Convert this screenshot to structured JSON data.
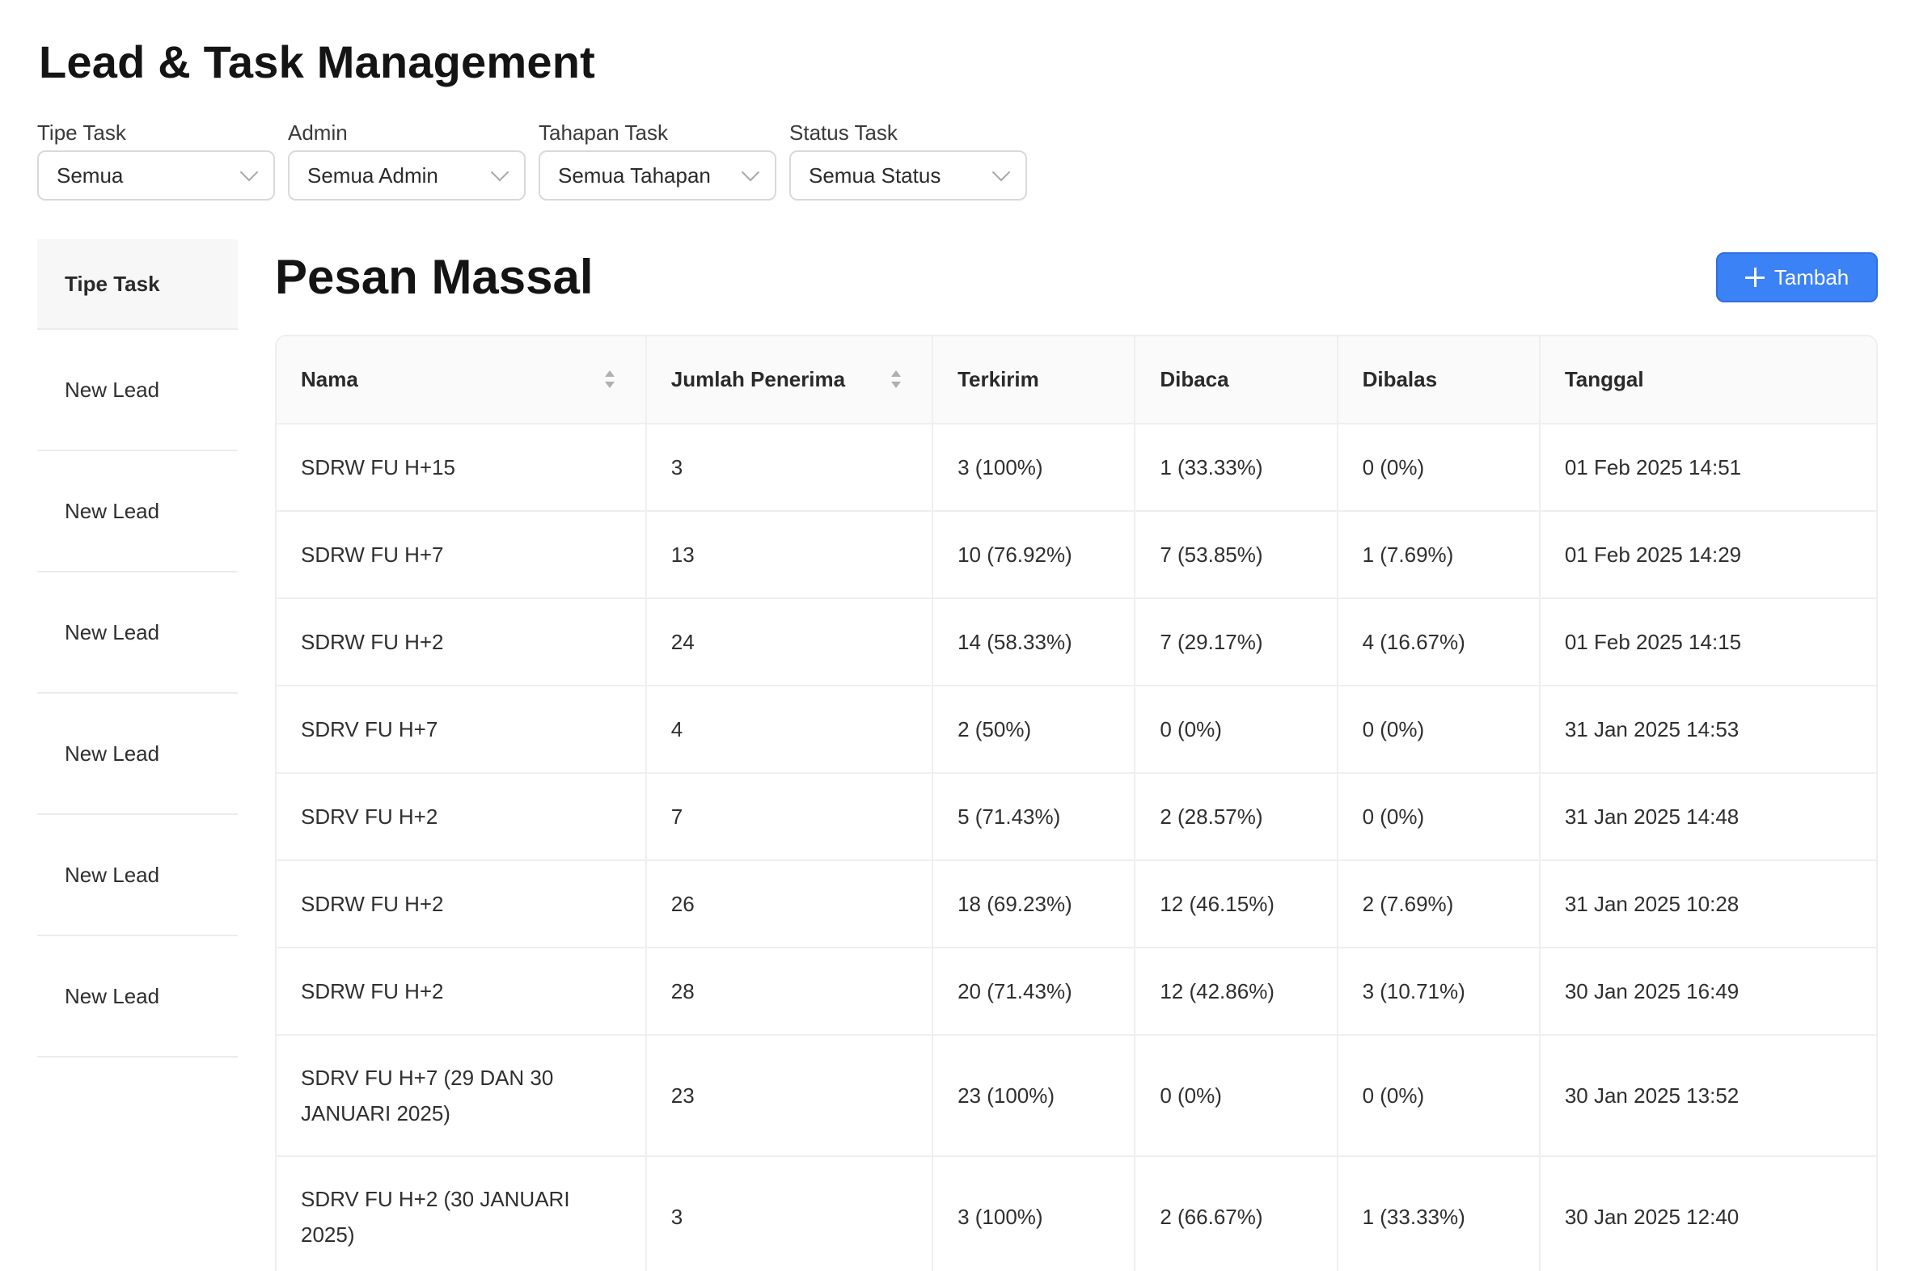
{
  "page_title": "Lead & Task Management",
  "filters": [
    {
      "label": "Tipe Task",
      "value": "Semua"
    },
    {
      "label": "Admin",
      "value": "Semua Admin"
    },
    {
      "label": "Tahapan Task",
      "value": "Semua Tahapan"
    },
    {
      "label": "Status Task",
      "value": "Semua Status"
    }
  ],
  "sidebar": {
    "header": "Tipe Task",
    "items": [
      "New Lead",
      "New Lead",
      "New Lead",
      "New Lead",
      "New Lead",
      "New Lead"
    ]
  },
  "section": {
    "title": "Pesan Massal",
    "add_label": "Tambah"
  },
  "table": {
    "columns": [
      "Nama",
      "Jumlah Penerima",
      "Terkirim",
      "Dibaca",
      "Dibalas",
      "Tanggal"
    ],
    "rows": [
      [
        "SDRW FU H+15",
        "3",
        "3 (100%)",
        "1 (33.33%)",
        "0 (0%)",
        "01 Feb 2025 14:51"
      ],
      [
        "SDRW FU H+7",
        "13",
        "10 (76.92%)",
        "7 (53.85%)",
        "1 (7.69%)",
        "01 Feb 2025 14:29"
      ],
      [
        "SDRW FU H+2",
        "24",
        "14 (58.33%)",
        "7 (29.17%)",
        "4 (16.67%)",
        "01 Feb 2025 14:15"
      ],
      [
        "SDRV FU H+7",
        "4",
        "2 (50%)",
        "0 (0%)",
        "0 (0%)",
        "31 Jan 2025 14:53"
      ],
      [
        "SDRV FU H+2",
        "7",
        "5 (71.43%)",
        "2 (28.57%)",
        "0 (0%)",
        "31 Jan 2025 14:48"
      ],
      [
        "SDRW FU H+2",
        "26",
        "18 (69.23%)",
        "12 (46.15%)",
        "2 (7.69%)",
        "31 Jan 2025 10:28"
      ],
      [
        "SDRW FU H+2",
        "28",
        "20 (71.43%)",
        "12 (42.86%)",
        "3 (10.71%)",
        "30 Jan 2025 16:49"
      ],
      [
        "SDRV FU H+7 (29 DAN 30 JANUARI 2025)",
        "23",
        "23 (100%)",
        "0 (0%)",
        "0 (0%)",
        "30 Jan 2025 13:52"
      ],
      [
        "SDRV FU H+2 (30 JANUARI 2025)",
        "3",
        "3 (100%)",
        "2 (66.67%)",
        "1 (33.33%)",
        "30 Jan 2025 12:40"
      ]
    ]
  },
  "colors": {
    "primary": "#3b82f6",
    "header_bg": "#fafafa",
    "border": "#efefef"
  }
}
